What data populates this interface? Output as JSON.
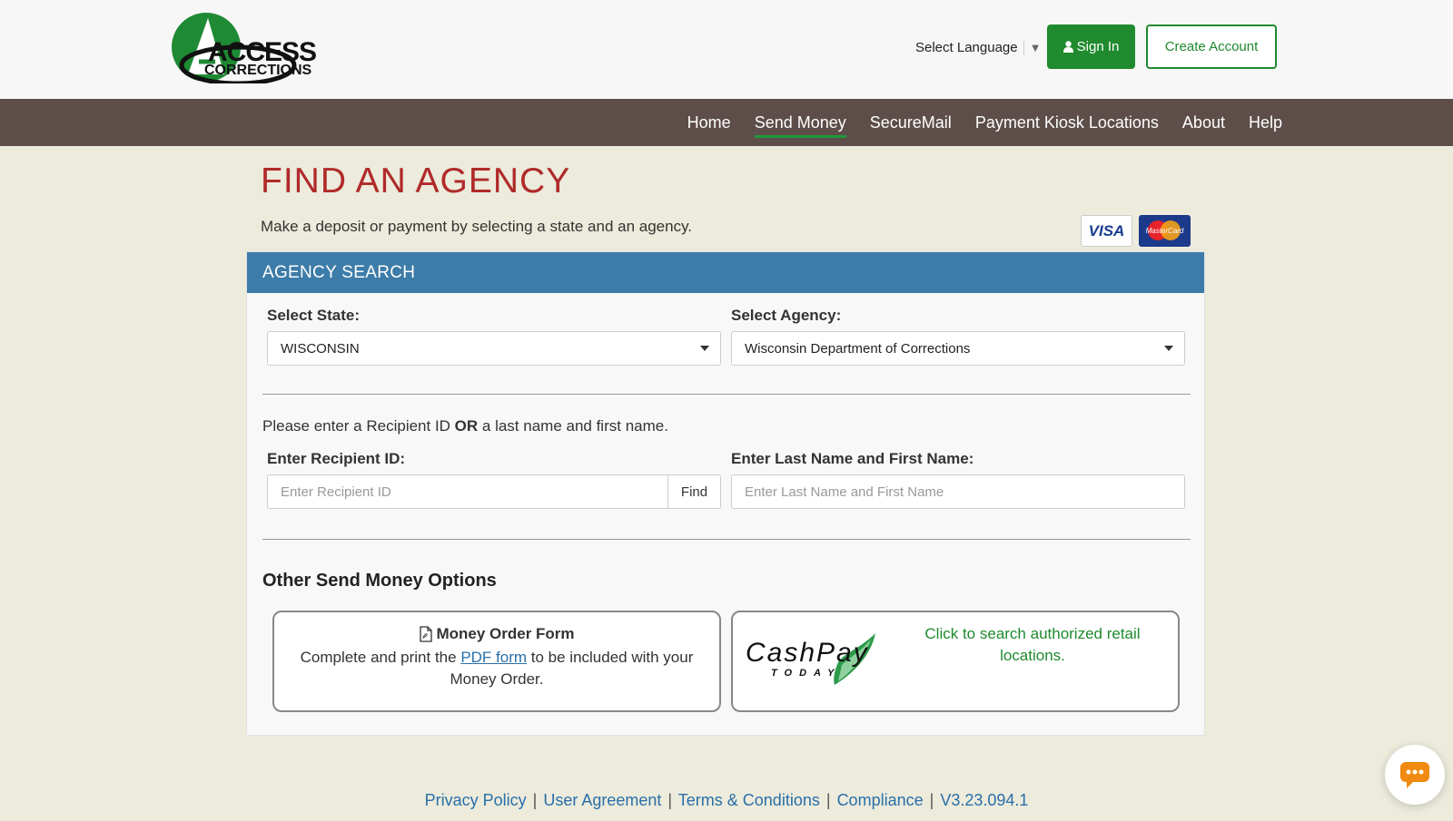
{
  "header": {
    "logo_text": "ACCESS CORRECTIONS",
    "language_label": "Select Language",
    "signin_label": "Sign In",
    "create_account_label": "Create Account"
  },
  "nav": {
    "items": [
      {
        "label": "Home"
      },
      {
        "label": "Send Money"
      },
      {
        "label": "SecureMail"
      },
      {
        "label": "Payment Kiosk Locations"
      },
      {
        "label": "About"
      },
      {
        "label": "Help"
      }
    ],
    "active": "Send Money"
  },
  "page": {
    "title": "FIND AN AGENCY",
    "subtitle": "Make a deposit or payment by selecting a state and an agency.",
    "cards": {
      "visa": "VISA",
      "mastercard": "MasterCard"
    }
  },
  "search": {
    "header": "AGENCY SEARCH",
    "state_label": "Select State:",
    "state_value": "WISCONSIN",
    "agency_label": "Select Agency:",
    "agency_value": "Wisconsin Department of Corrections",
    "instruction_prefix": "Please enter a Recipient ID ",
    "instruction_bold": "OR",
    "instruction_suffix": " a last name and first name.",
    "recipient_label": "Enter Recipient ID:",
    "recipient_placeholder": "Enter Recipient ID",
    "find_label": "Find",
    "name_label": "Enter Last Name and First Name:",
    "name_placeholder": "Enter Last Name and First Name"
  },
  "options": {
    "title": "Other Send Money Options",
    "money_order": {
      "title": "Money Order Form",
      "text_before": "Complete and print the ",
      "link": "PDF form",
      "text_after": " to be included with your Money Order."
    },
    "cashpay": {
      "logo_main": "CashPay",
      "logo_sub": "TODAY",
      "text": "Click to search authorized retail locations."
    }
  },
  "footer": {
    "links": [
      "Privacy Policy",
      "User Agreement",
      "Terms & Conditions",
      "Compliance",
      "V3.23.094.1"
    ]
  },
  "colors": {
    "brand_green": "#1f8a2e",
    "nav_bg": "#5d4e4a",
    "title_red": "#b02a2a",
    "panel_header": "#3d7ca8",
    "page_bg": "#ecebdc",
    "chat_orange": "#f08a10"
  },
  "icons": {
    "signin": "user-icon",
    "language": "caret-down-icon",
    "money_order": "pdf-file-icon",
    "chat": "chat-bubble-icon"
  }
}
